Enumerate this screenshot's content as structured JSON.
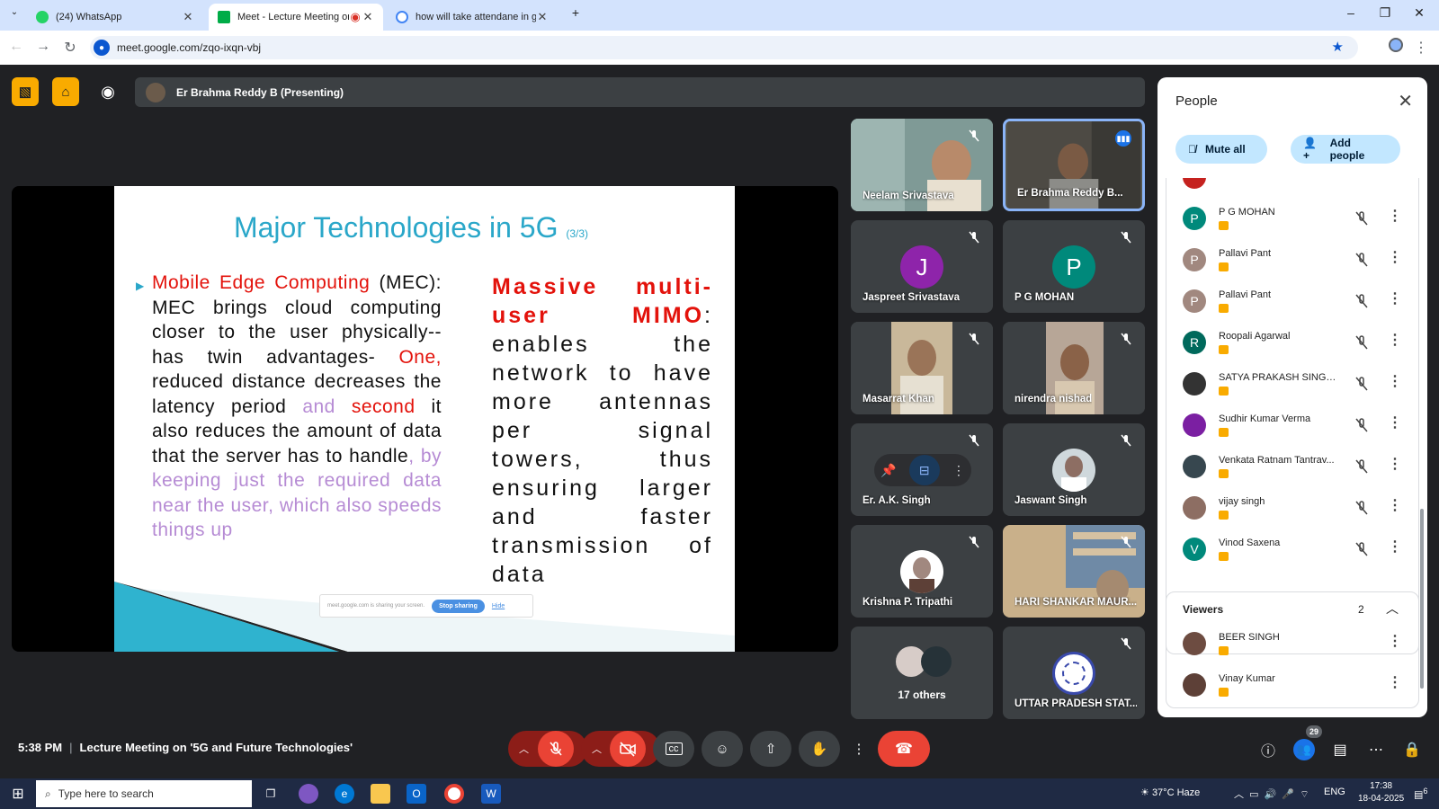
{
  "browser": {
    "tabs": [
      {
        "title": "(24) WhatsApp",
        "active": false,
        "favicon_color": "#25d366"
      },
      {
        "title": "Meet - Lecture Meeting on",
        "active": true,
        "favicon_color": "#00ac47"
      },
      {
        "title": "how will take attendane in goo",
        "active": false,
        "favicon_color": "#4285f4"
      }
    ],
    "new_tab": "+",
    "url": "meet.google.com/zqo-ixqn-vbj"
  },
  "meet": {
    "presenting_label": "Er Brahma Reddy B (Presenting)",
    "slide": {
      "title": "Major Technologies in 5G",
      "title_suffix": "(3/3)",
      "left_red_head": "Mobile Edge Computing",
      "left_text_1": "(MEC): MEC brings cloud computing closer to the user physically--has twin advantages-",
      "left_red_one": "One,",
      "left_text_2": "reduced distance decreases the latency period",
      "left_lav_and": "and",
      "left_red_second": "second",
      "left_text_3": "it also reduces the amount of data that the server has to handle",
      "left_lav_tail": ", by keeping just the required data near the user, which also speeds things up",
      "right_red_head": "Massive multi-user MIMO",
      "right_text": ": enables the network to have more antennas per signal towers, thus ensuring larger and faster transmission of data",
      "share_notice": "meet.google.com is sharing your screen.",
      "stop_sharing": "Stop sharing",
      "hide": "Hide"
    },
    "tiles": [
      {
        "name": "Neelam Srivastava",
        "type": "photo",
        "muted": true
      },
      {
        "name": "Er Brahma Reddy B...",
        "type": "photo",
        "speaking": true
      },
      {
        "name": "Jaspreet Srivastava",
        "type": "avatar",
        "initial": "J",
        "color": "#8e24aa",
        "muted": true
      },
      {
        "name": "P G MOHAN",
        "type": "avatar",
        "initial": "P",
        "color": "#00897b",
        "muted": true
      },
      {
        "name": "Masarrat Khan",
        "type": "photo",
        "muted": true
      },
      {
        "name": "nirendra nishad",
        "type": "photo",
        "muted": true
      },
      {
        "name": "Er. A.K. Singh",
        "type": "controls",
        "muted": true
      },
      {
        "name": "Jaswant Singh",
        "type": "avatarphoto",
        "muted": true
      },
      {
        "name": "Krishna P. Tripathi",
        "type": "avatarphoto",
        "muted": true
      },
      {
        "name": "HARI SHANKAR MAUR...",
        "type": "photo",
        "muted": true
      },
      {
        "name": "17 others",
        "type": "others"
      },
      {
        "name": "UTTAR PRADESH STAT...",
        "type": "logo",
        "muted": true
      }
    ]
  },
  "people_panel": {
    "title": "People",
    "mute_all": "Mute all",
    "add_people": "Add people",
    "participants": [
      {
        "name": "P G MOHAN",
        "initial": "P",
        "color": "#00897b"
      },
      {
        "name": "Pallavi Pant",
        "initial": "P",
        "color": "#a1887f"
      },
      {
        "name": "Pallavi Pant",
        "initial": "P",
        "color": "#a1887f"
      },
      {
        "name": "Roopali Agarwal",
        "initial": "R",
        "color": "#00695c"
      },
      {
        "name": "SATYA PRAKASH SINGH...",
        "initial": "",
        "color": "#333333"
      },
      {
        "name": "Sudhir Kumar Verma",
        "initial": "",
        "color": "#7b1fa2"
      },
      {
        "name": "Venkata Ratnam Tantrav...",
        "initial": "",
        "color": "#37474f"
      },
      {
        "name": "vijay singh",
        "initial": "",
        "color": "#8d6e63"
      },
      {
        "name": "Vinod Saxena",
        "initial": "V",
        "color": "#00897b"
      }
    ],
    "viewers_label": "Viewers",
    "viewers_count": "2",
    "viewers": [
      {
        "name": "BEER SINGH",
        "color": "#6d4c41"
      },
      {
        "name": "Vinay Kumar",
        "color": "#5d4037"
      }
    ]
  },
  "bottom": {
    "time": "5:38 PM",
    "meeting_title": "Lecture Meeting on '5G and Future Technologies'",
    "people_count": "29"
  },
  "taskbar": {
    "search_placeholder": "Type here to search",
    "weather": "37°C  Haze",
    "lang": "ENG",
    "clock_time": "17:38",
    "clock_date": "18-04-2025",
    "notif_count": "6"
  }
}
